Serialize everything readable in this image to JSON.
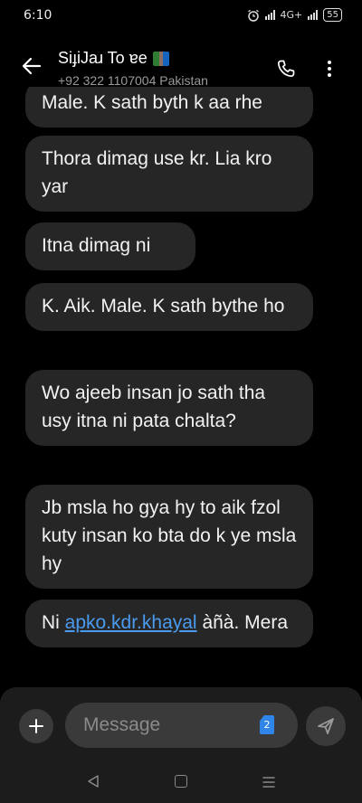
{
  "status_bar": {
    "time": "6:10",
    "network_label": "4G+",
    "battery": "55"
  },
  "header": {
    "contact_name": "SiɟiJaɹ To ɐe",
    "contact_detail": "+92 322 1107004  Pakistan"
  },
  "messages": [
    {
      "text": "Male. K sath byth k aa rhe"
    },
    {
      "text": "Thora dimag use kr. Lia kro yar"
    },
    {
      "text": "Itna dimag ni"
    },
    {
      "text": "K. Aik. Male. K sath bythe ho"
    },
    {
      "text": "Wo ajeeb  insan jo sath tha usy itna ni pata chalta?"
    },
    {
      "text": "Jb msla ho gya hy to aik fzol kuty insan ko bta do k ye msla hy"
    },
    {
      "prefix": "Ni ",
      "link": "apko.kdr.khayal",
      "suffix": " àñà. Mera"
    }
  ],
  "composer": {
    "placeholder": "Message",
    "sim_slot": "2"
  },
  "colors": {
    "bubble": "#262626",
    "link": "#4a9bef",
    "sim_badge": "#2f86e8"
  },
  "icons": [
    "alarm-icon",
    "signal-icon",
    "battery-icon",
    "back-arrow-icon",
    "book-emoji-icon",
    "phone-icon",
    "more-vert-icon",
    "plus-icon",
    "sim-card-icon",
    "send-icon",
    "nav-back-icon",
    "nav-home-icon",
    "nav-recents-icon"
  ]
}
